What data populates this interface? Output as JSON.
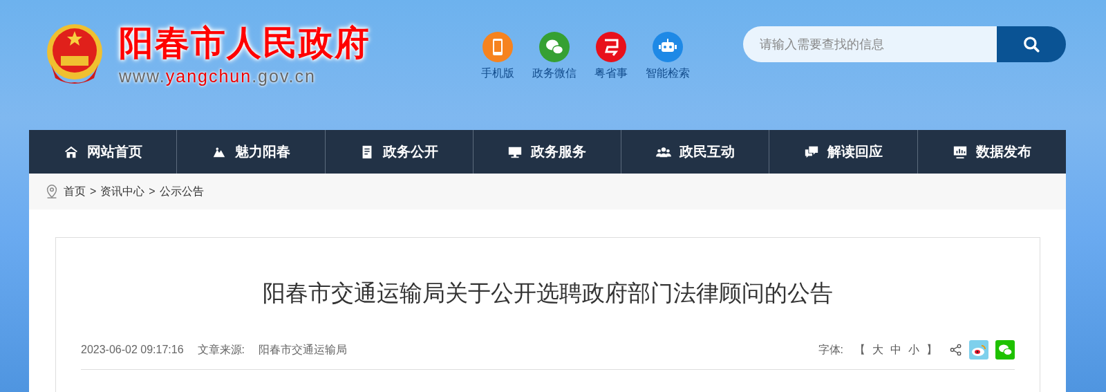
{
  "header": {
    "site_title": "阳春市人民政府",
    "url_parts": [
      {
        "text": "www.",
        "highlight": false
      },
      {
        "text": "yangchun",
        "highlight": true
      },
      {
        "text": ".gov.cn",
        "highlight": false
      }
    ],
    "quick_links": [
      {
        "label": "手机版",
        "kind": "phone"
      },
      {
        "label": "政务微信",
        "kind": "wechat"
      },
      {
        "label": "粤省事",
        "kind": "yue"
      },
      {
        "label": "智能检索",
        "kind": "robot"
      }
    ],
    "search": {
      "placeholder": "请输入需要查找的信息"
    }
  },
  "nav": [
    {
      "label": "网站首页",
      "kind": "home"
    },
    {
      "label": "魅力阳春",
      "kind": "scenery"
    },
    {
      "label": "政务公开",
      "kind": "doc"
    },
    {
      "label": "政务服务",
      "kind": "monitor"
    },
    {
      "label": "政民互动",
      "kind": "people"
    },
    {
      "label": "解读回应",
      "kind": "chat"
    },
    {
      "label": "数据发布",
      "kind": "chart"
    }
  ],
  "breadcrumb": {
    "separator": ">",
    "items": [
      "首页",
      "资讯中心",
      "公示公告"
    ]
  },
  "article": {
    "title": "阳春市交通运输局关于公开选聘政府部门法律顾问的公告",
    "date": "2023-06-02 09:17:16",
    "source_label": "文章来源:",
    "source": "阳春市交通运输局",
    "font_label": "字体:",
    "bracket_open": "【",
    "bracket_close": "】",
    "font_sizes": [
      "大",
      "中",
      "小"
    ]
  }
}
